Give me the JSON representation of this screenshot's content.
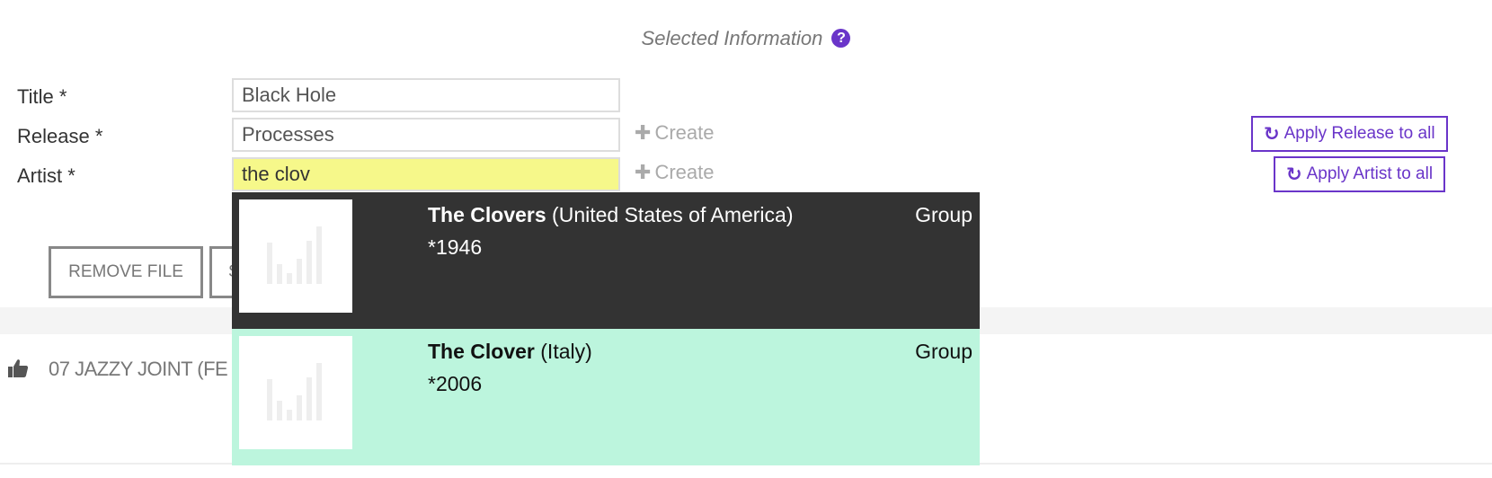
{
  "section": {
    "title": "Selected Information",
    "help_icon": "?"
  },
  "fields": {
    "title": {
      "label": "Title *",
      "value": "Black Hole"
    },
    "release": {
      "label": "Release *",
      "value": "Processes",
      "create_label": "Create"
    },
    "artist": {
      "label": "Artist *",
      "value": "the clov",
      "create_label": "Create"
    }
  },
  "apply_buttons": {
    "release": "Apply Release to all",
    "artist": "Apply Artist to all"
  },
  "actions": {
    "remove_file": "REMOVE FILE",
    "second_button_partial": "S"
  },
  "file_row": {
    "icon": "thumbs-up-icon",
    "text": "07 JAZZY JOINT (FE"
  },
  "dropdown": {
    "results": [
      {
        "name": "The Clovers",
        "country": "(United States of America)",
        "year": "*1946",
        "type": "Group"
      },
      {
        "name": "The Clover",
        "country": "(Italy)",
        "year": "*2006",
        "type": "Group"
      }
    ]
  },
  "colors": {
    "accent": "#6a35c9",
    "input_active": "#f6f88a",
    "dark_item": "#333333",
    "highlight_item": "#bcf5dd"
  }
}
